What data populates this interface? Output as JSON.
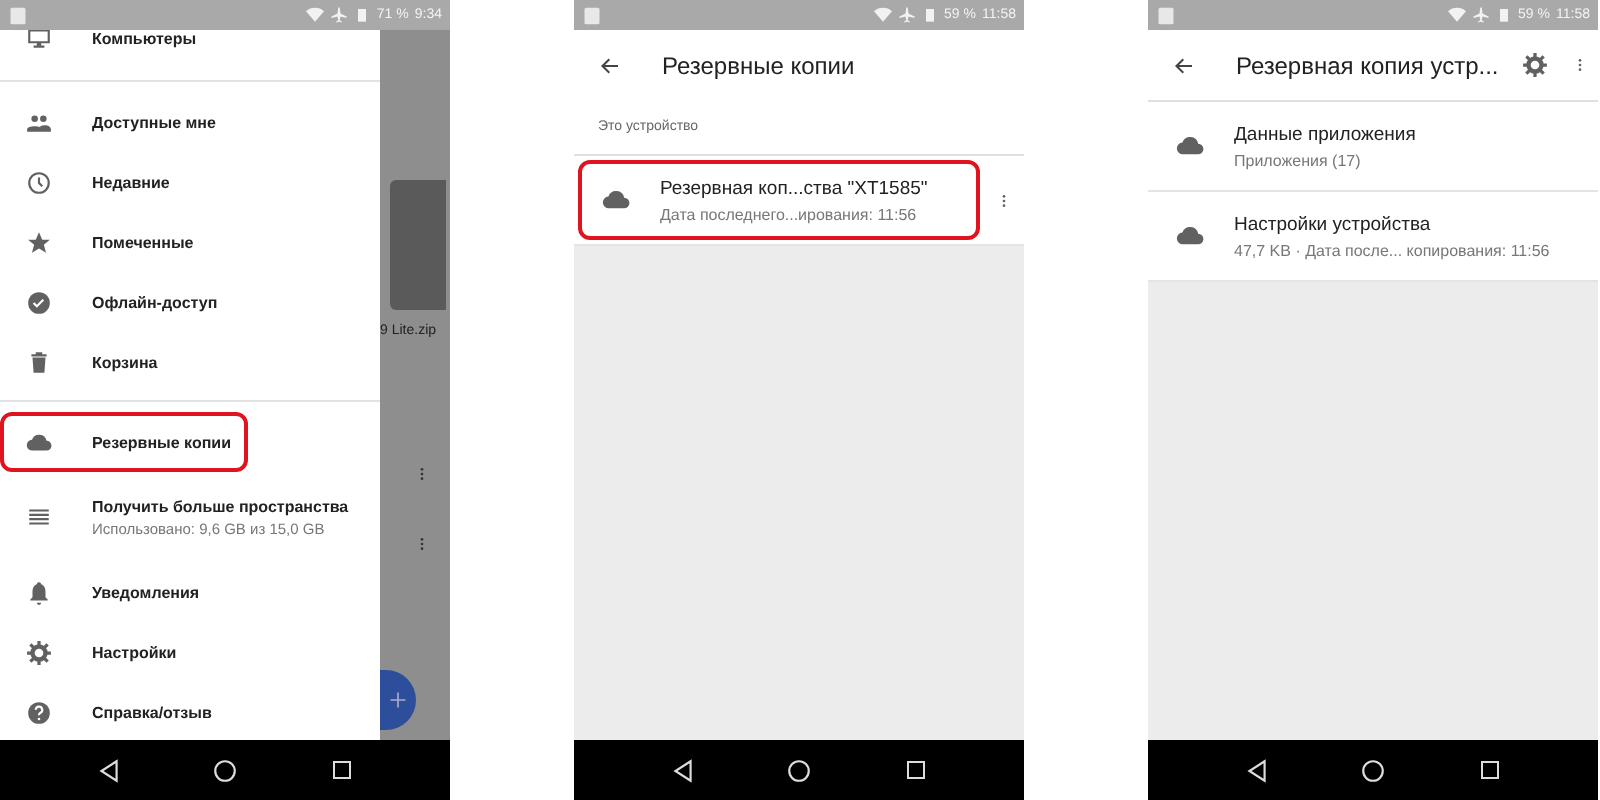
{
  "phones": [
    {
      "kind": "drawer",
      "status_bar": {
        "battery": "71 %",
        "time": "9:34"
      },
      "background": {
        "file_name": "9 Lite.zip"
      },
      "drawer": {
        "sections": [
          [
            {
              "label": "Компьютеры",
              "highlighted": false
            }
          ],
          [
            {
              "label": "Доступные мне",
              "highlighted": false
            },
            {
              "label": "Недавние",
              "highlighted": false
            },
            {
              "label": "Помеченные",
              "highlighted": false
            },
            {
              "label": "Офлайн-доступ",
              "highlighted": false
            },
            {
              "label": "Корзина",
              "highlighted": false
            }
          ],
          [
            {
              "label": "Резервные копии",
              "highlighted": true
            },
            {
              "label": "Получить больше пространства",
              "sublabel": "Использовано: 9,6 GB из 15,0 GB",
              "highlighted": false
            },
            {
              "label": "Уведомления",
              "highlighted": false
            },
            {
              "label": "Настройки",
              "highlighted": false
            },
            {
              "label": "Справка/отзыв",
              "highlighted": false
            }
          ]
        ]
      }
    },
    {
      "kind": "list",
      "status_bar": {
        "battery": "59 %",
        "time": "11:58"
      },
      "title": "Резервные копии",
      "section_label": "Это устройство",
      "rows": [
        {
          "title": "Резервная коп...ства \"XT1585\"",
          "subtitle": "Дата последнего...ирования: 11:56",
          "highlighted": true,
          "menu": true
        }
      ]
    },
    {
      "kind": "list",
      "status_bar": {
        "battery": "59 %",
        "time": "11:58"
      },
      "title": "Резервная копия устр...",
      "settings": true,
      "rows": [
        {
          "title": "Данные приложения",
          "subtitle": "Приложения (17)",
          "highlighted": false,
          "menu": false
        },
        {
          "title": "Настройки устройства",
          "subtitle": "47,7 KB · Дата после... копирования: 11:56",
          "highlighted": false,
          "menu": false
        }
      ]
    }
  ]
}
